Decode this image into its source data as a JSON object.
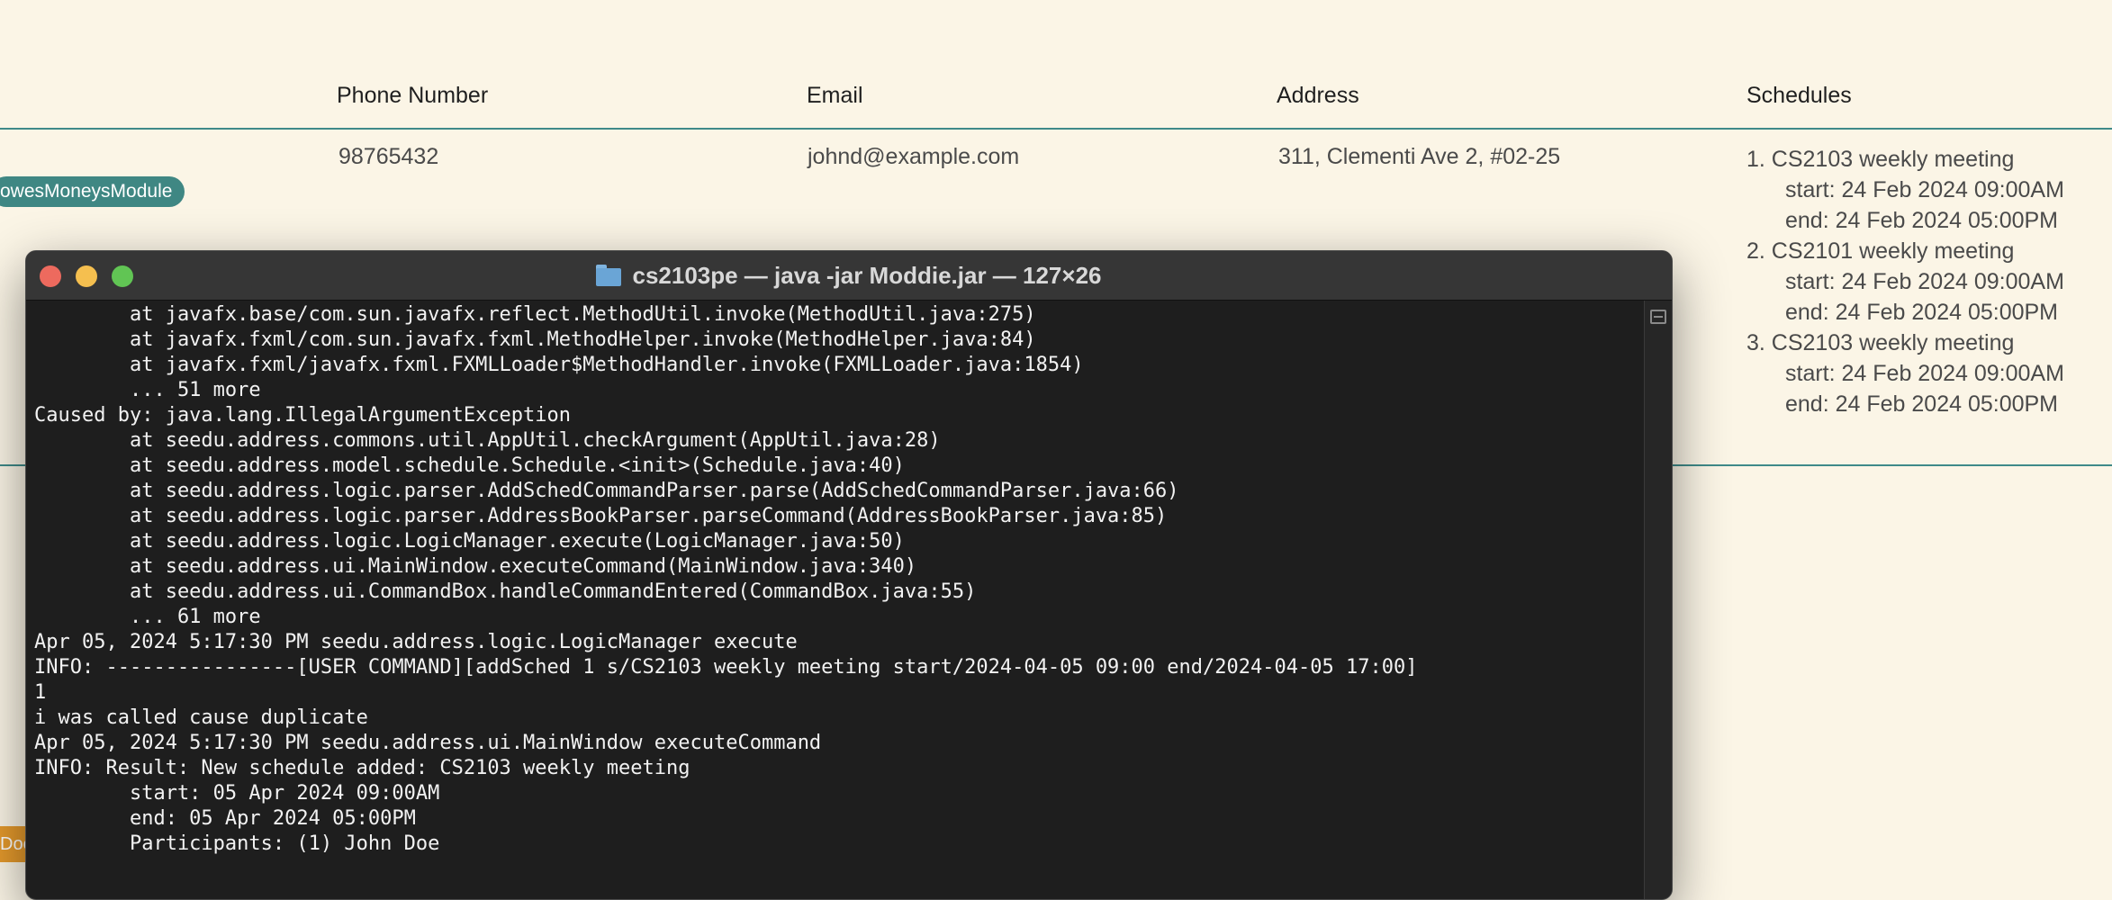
{
  "table": {
    "headers": {
      "phone": "Phone Number",
      "email": "Email",
      "address": "Address",
      "schedules": "Schedules"
    },
    "row": {
      "tag": "owesMoneysModule",
      "phone": "98765432",
      "email": "johnd@example.com",
      "address": "311, Clementi Ave 2, #02-25",
      "schedules": [
        {
          "title": "1. CS2103 weekly meeting",
          "start": "start: 24 Feb 2024 09:00AM",
          "end": "end: 24 Feb 2024 05:00PM"
        },
        {
          "title": "2. CS2101 weekly meeting",
          "start": "start: 24 Feb 2024 09:00AM",
          "end": "end: 24 Feb 2024 05:00PM"
        },
        {
          "title": "3. CS2103 weekly meeting",
          "start": "start: 24 Feb 2024 09:00AM",
          "end": "end: 24 Feb 2024 05:00PM"
        }
      ]
    },
    "next_row_tag": "Doe"
  },
  "terminal": {
    "title": "cs2103pe — java -jar Moddie.jar — 127×26",
    "lines": [
      "        at javafx.base/com.sun.javafx.reflect.MethodUtil.invoke(MethodUtil.java:275)",
      "        at javafx.fxml/com.sun.javafx.fxml.MethodHelper.invoke(MethodHelper.java:84)",
      "        at javafx.fxml/javafx.fxml.FXMLLoader$MethodHandler.invoke(FXMLLoader.java:1854)",
      "        ... 51 more",
      "Caused by: java.lang.IllegalArgumentException",
      "        at seedu.address.commons.util.AppUtil.checkArgument(AppUtil.java:28)",
      "        at seedu.address.model.schedule.Schedule.<init>(Schedule.java:40)",
      "        at seedu.address.logic.parser.AddSchedCommandParser.parse(AddSchedCommandParser.java:66)",
      "        at seedu.address.logic.parser.AddressBookParser.parseCommand(AddressBookParser.java:85)",
      "        at seedu.address.logic.LogicManager.execute(LogicManager.java:50)",
      "        at seedu.address.ui.MainWindow.executeCommand(MainWindow.java:340)",
      "        at seedu.address.ui.CommandBox.handleCommandEntered(CommandBox.java:55)",
      "        ... 61 more",
      "Apr 05, 2024 5:17:30 PM seedu.address.logic.LogicManager execute",
      "INFO: ----------------[USER COMMAND][addSched 1 s/CS2103 weekly meeting start/2024-04-05 09:00 end/2024-04-05 17:00]",
      "1",
      "i was called cause duplicate",
      "Apr 05, 2024 5:17:30 PM seedu.address.ui.MainWindow executeCommand",
      "INFO: Result: New schedule added: CS2103 weekly meeting",
      "        start: 05 Apr 2024 09:00AM",
      "        end: 05 Apr 2024 05:00PM",
      "        Participants: (1) John Doe"
    ]
  }
}
